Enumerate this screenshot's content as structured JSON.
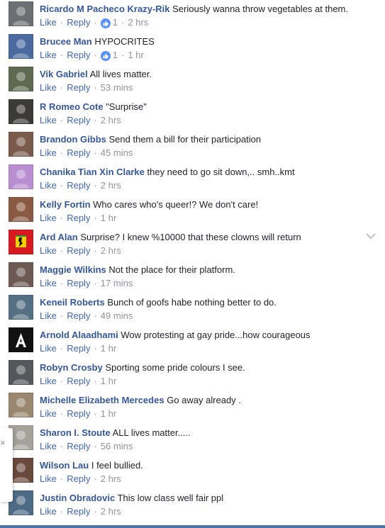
{
  "actions": {
    "like": "Like",
    "reply": "Reply",
    "separator": "·"
  },
  "comments": [
    {
      "author": "Ricardo M Pacheco Krazy-Rik",
      "text": "Seriously wanna throw vegetables at them.",
      "reactions": "1",
      "time": "2 hrs",
      "avatar_icon": "profile-photo",
      "avatar_color": "#6b6e73"
    },
    {
      "author": "Brucee Man",
      "text": "HYPOCRITES",
      "reactions": "1",
      "time": "1 hr",
      "avatar_icon": "profile-photo",
      "avatar_color": "#4a6aa0"
    },
    {
      "author": "Vik Gabriel",
      "text": "All lives matter.",
      "time": "53 mins",
      "avatar_icon": "profile-photo",
      "avatar_color": "#5d6a4f"
    },
    {
      "author": "R Romeo Cote",
      "text": "\"Surprise\"",
      "time": "2 hrs",
      "avatar_icon": "profile-photo",
      "avatar_color": "#3b3a37"
    },
    {
      "author": "Brandon Gibbs",
      "text": "Send them a bill for their participation",
      "time": "45 mins",
      "avatar_icon": "profile-photo",
      "avatar_color": "#7a5b4b"
    },
    {
      "author": "Chanika Tian Xin Clarke",
      "text": "they need to go sit down,.. smh..kmt",
      "time": "2 hrs",
      "avatar_icon": "profile-photo",
      "avatar_color": "#b98fd1"
    },
    {
      "author": "Kelly Fortin",
      "text": "Who cares who's queer!? We don't care!",
      "time": "1 hr",
      "avatar_icon": "profile-photo",
      "avatar_color": "#8a5a43"
    },
    {
      "author": "Ard Alan",
      "text": "Surprise? I knew %10000 that these clowns will return",
      "time": "2 hrs",
      "avatar_icon": "ferrari-logo",
      "avatar_color": "#d71920"
    },
    {
      "author": "Maggie Wilkins",
      "text": "Not the place for their platform.",
      "time": "17 mins",
      "avatar_icon": "profile-photo",
      "avatar_color": "#6e5a54"
    },
    {
      "author": "Keneil Roberts",
      "text": "Bunch of goofs habe nothing better to do.",
      "time": "49 mins",
      "avatar_icon": "profile-photo",
      "avatar_color": "#567083"
    },
    {
      "author": "Arnold Alaadhami",
      "text": "Wow protesting at gay pride...how courageous",
      "time": "1 hr",
      "avatar_icon": "letter-a-logo",
      "avatar_color": "#111111"
    },
    {
      "author": "Robyn Crosby",
      "text": "Sporting some pride colours I see.",
      "time": "1 hr",
      "avatar_icon": "profile-photo",
      "avatar_color": "#54585c"
    },
    {
      "author": "Michelle Elizabeth Mercedes",
      "text": "Go away already .",
      "time": "1 hr",
      "avatar_icon": "profile-photo",
      "avatar_color": "#9a8770"
    },
    {
      "author": "Sharon I. Stoute",
      "text": "ALL lives matter.....",
      "time": "56 mins",
      "avatar_icon": "profile-photo",
      "avatar_color": "#a5a29b"
    },
    {
      "author": "Wilson Lau",
      "text": "I feel bullied.",
      "time": "2 hrs",
      "avatar_icon": "profile-photo",
      "avatar_color": "#6b4a3e"
    },
    {
      "author": "Justin Obradovic",
      "text": "This low class well fair ppl",
      "time": "2 hrs",
      "avatar_icon": "profile-photo",
      "avatar_color": "#4e6b86"
    }
  ],
  "side_panel": {
    "close_glyph": "×"
  },
  "colors": {
    "link": "#365899",
    "action": "#4267b2",
    "meta": "#90949c",
    "text": "#1d2129",
    "like_badge": "#5890ff"
  }
}
